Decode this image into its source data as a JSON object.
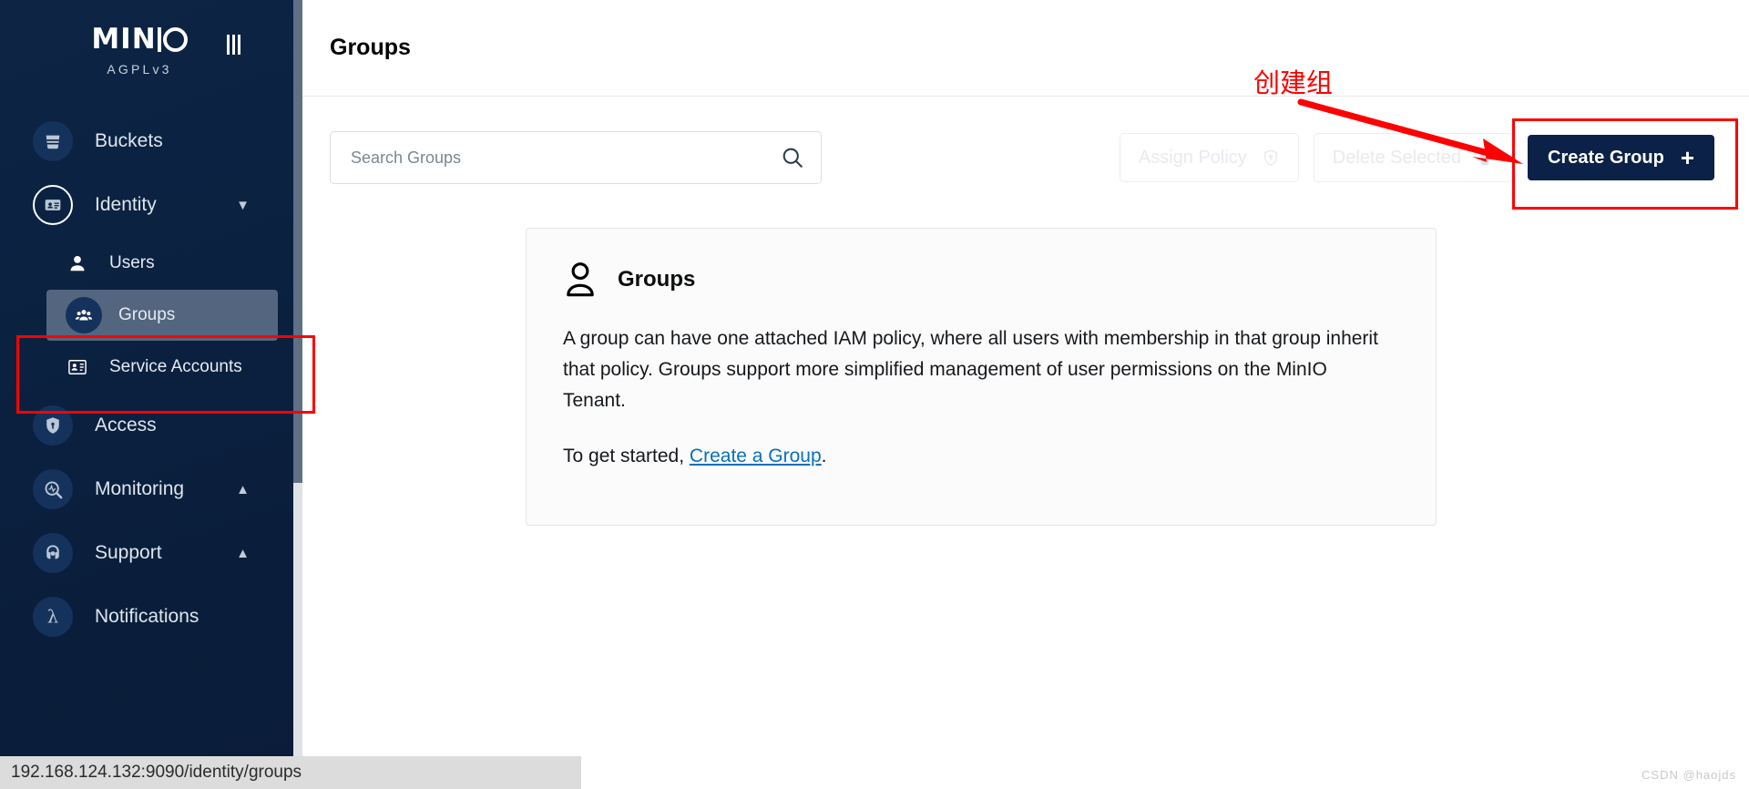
{
  "brand": {
    "logo_text": "MINIO",
    "license": "AGPLv3",
    "menu_toggle_icon": "hamburger-vertical-icon"
  },
  "sidebar": {
    "items": [
      {
        "label": "Buckets",
        "icon": "bucket-icon",
        "type": "top",
        "expandable": false
      },
      {
        "label": "Identity",
        "icon": "identity-card-icon",
        "type": "top",
        "expandable": true,
        "chevron": "chevron-down-icon",
        "expanded": true
      },
      {
        "label": "Users",
        "icon": "user-icon",
        "type": "sub",
        "active": false
      },
      {
        "label": "Groups",
        "icon": "group-people-icon",
        "type": "sub",
        "active": true
      },
      {
        "label": "Service Accounts",
        "icon": "service-account-icon",
        "type": "sub",
        "active": false
      },
      {
        "label": "Access",
        "icon": "lock-shield-icon",
        "type": "top",
        "expandable": false
      },
      {
        "label": "Monitoring",
        "icon": "monitoring-pulse-icon",
        "type": "top",
        "expandable": true,
        "chevron": "chevron-up-icon"
      },
      {
        "label": "Support",
        "icon": "headset-support-icon",
        "type": "top",
        "expandable": true,
        "chevron": "chevron-up-icon"
      },
      {
        "label": "Notifications",
        "icon": "lambda-icon",
        "type": "top",
        "expandable": false
      }
    ]
  },
  "header": {
    "title": "Groups"
  },
  "toolbar": {
    "search_placeholder": "Search Groups",
    "search_value": "",
    "search_icon": "search-icon",
    "assign_policy_label": "Assign Policy",
    "assign_policy_icon": "shield-icon",
    "delete_selected_label": "Delete Selected",
    "delete_selected_icon": "trash-icon",
    "create_group_label": "Create Group",
    "create_group_icon": "plus-icon"
  },
  "info_card": {
    "icon": "person-outline-icon",
    "title": "Groups",
    "body": "A group can have one attached IAM policy, where all users with membership in that group inherit that policy. Groups support more simplified management of user permissions on the MinIO Tenant.",
    "cta_prefix": "To get started, ",
    "cta_link": "Create a Group",
    "cta_suffix": "."
  },
  "annotations": {
    "create_group_label_cn": "创建组",
    "color": "#fe0000"
  },
  "statusbar": {
    "url": "192.168.124.132:9090/identity/groups"
  },
  "watermark": {
    "text": "CSDN @haojds"
  },
  "colors": {
    "sidebar_bg": "#0b2140",
    "primary_button": "#0b2147",
    "link": "#0871b9",
    "annotation_red": "#fe0000",
    "active_sub_item": "#54657f"
  }
}
